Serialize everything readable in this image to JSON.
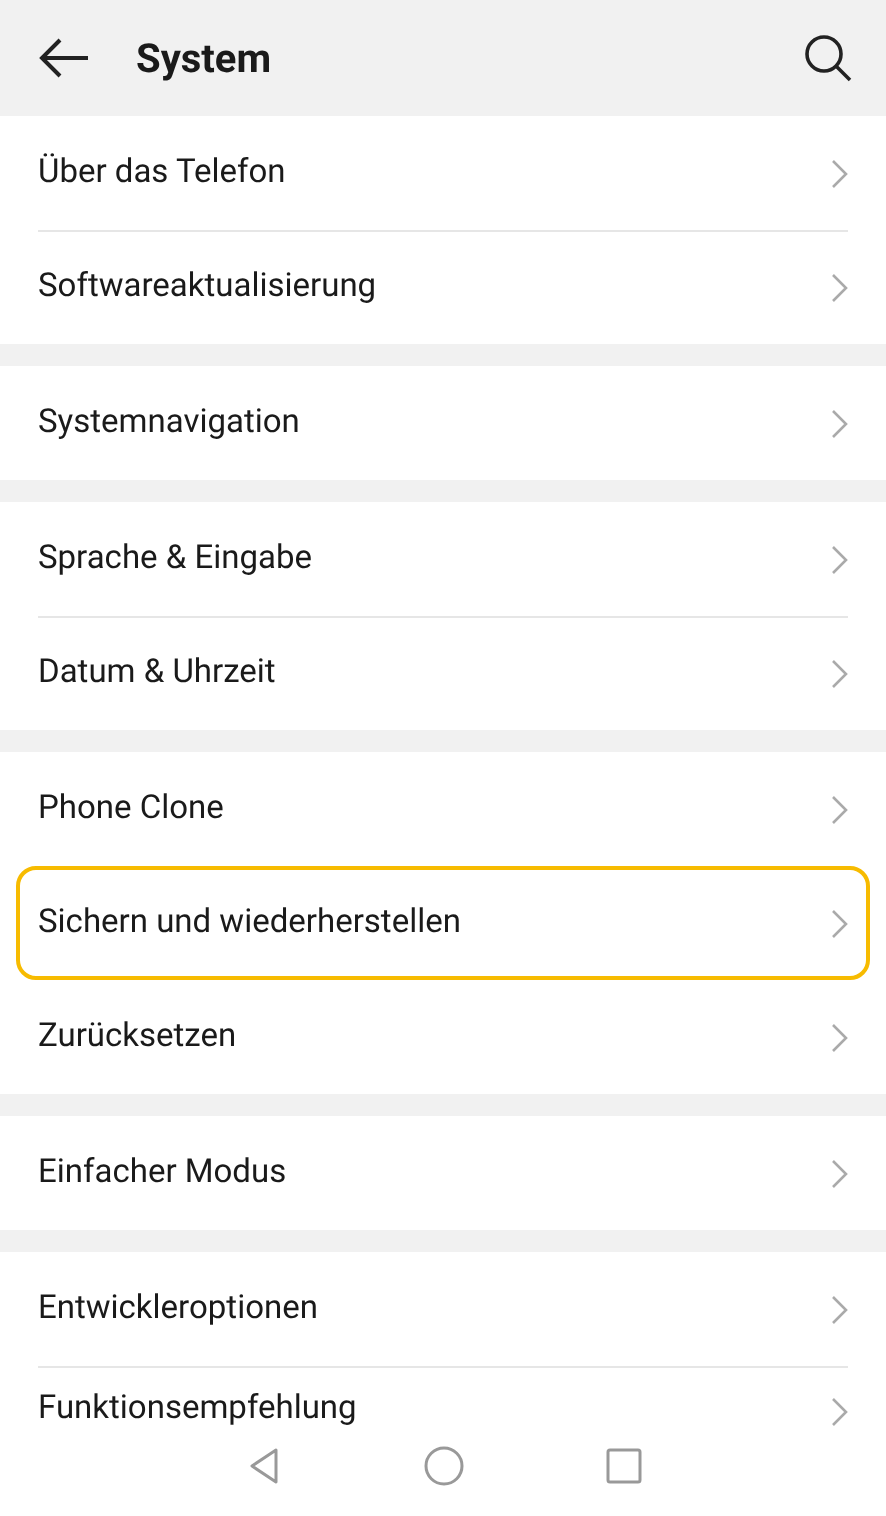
{
  "header": {
    "title": "System"
  },
  "groups": [
    {
      "items": [
        {
          "label": "Über das Telefon",
          "selected": false
        },
        {
          "label": "Softwareaktualisierung",
          "selected": false
        }
      ]
    },
    {
      "items": [
        {
          "label": "Systemnavigation",
          "selected": false
        }
      ]
    },
    {
      "items": [
        {
          "label": "Sprache & Eingabe",
          "selected": false
        },
        {
          "label": "Datum & Uhrzeit",
          "selected": false
        }
      ]
    },
    {
      "items": [
        {
          "label": "Phone Clone",
          "selected": false
        },
        {
          "label": "Sichern und wiederherstellen",
          "selected": true
        },
        {
          "label": "Zurücksetzen",
          "selected": false
        }
      ]
    },
    {
      "items": [
        {
          "label": "Einfacher Modus",
          "selected": false
        }
      ]
    },
    {
      "items": [
        {
          "label": "Entwickleroptionen",
          "selected": false
        },
        {
          "label": "Funktionsempfehlung",
          "selected": false
        }
      ]
    }
  ]
}
